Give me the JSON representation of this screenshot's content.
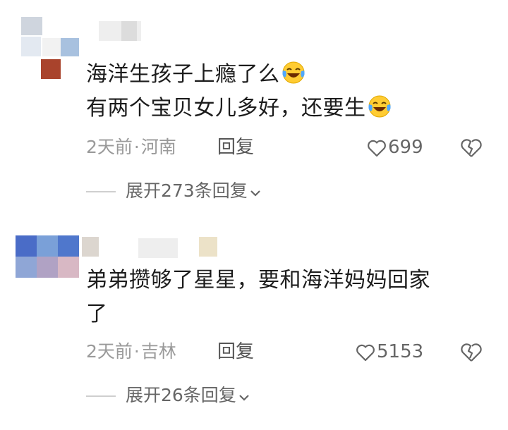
{
  "comments": [
    {
      "body_lines": [
        "海洋生孩子上瘾了么",
        "有两个宝贝女儿多好，还要生"
      ],
      "emoji_icon": "laughing-crying-emoji",
      "time": "2天前",
      "dot": "·",
      "location": "河南",
      "reply_label": "回复",
      "likes": "699",
      "expand_label": "展开273条回复"
    },
    {
      "body_lines": [
        "弟弟攒够了星星，要和海洋妈妈回家",
        "了"
      ],
      "time": "2天前",
      "dot": "·",
      "location": "吉林",
      "reply_label": "回复",
      "likes": "5153",
      "expand_label": "展开26条回复"
    }
  ],
  "icons": {
    "like": "heart-outline-icon",
    "dislike": "broken-heart-icon",
    "expand": "chevron-down-icon"
  },
  "colors": {
    "text": "#1c1c1c",
    "meta": "#9a9a9a",
    "action": "#555555"
  }
}
